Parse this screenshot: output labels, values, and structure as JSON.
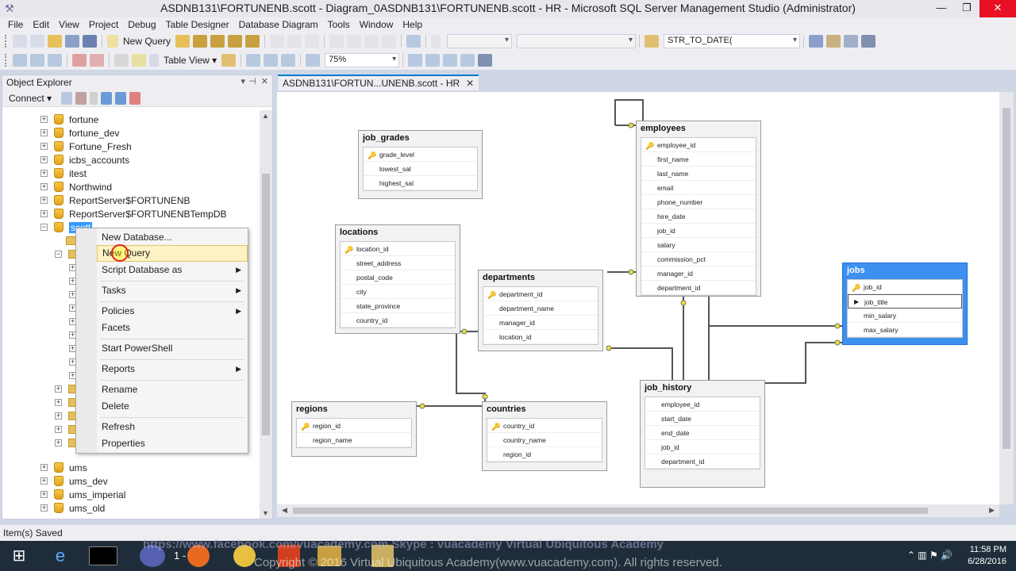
{
  "window": {
    "title": "ASDNB131\\FORTUNENB.scott - Diagram_0ASDNB131\\FORTUNENB.scott - HR - Microsoft SQL Server Management Studio (Administrator)",
    "minimize": "—",
    "restore": "❐",
    "close": "✕"
  },
  "menu": [
    "File",
    "Edit",
    "View",
    "Project",
    "Debug",
    "Table Designer",
    "Database Diagram",
    "Tools",
    "Window",
    "Help"
  ],
  "toolbar": {
    "new_query": "New Query",
    "function_combo": "STR_TO_DATE(",
    "table_view": "Table View",
    "zoom": "75%"
  },
  "object_explorer": {
    "title": "Object Explorer",
    "connect": "Connect",
    "nodes": [
      {
        "label": "fortune",
        "type": "db"
      },
      {
        "label": "fortune_dev",
        "type": "db"
      },
      {
        "label": "Fortune_Fresh",
        "type": "db"
      },
      {
        "label": "icbs_accounts",
        "type": "db"
      },
      {
        "label": "itest",
        "type": "db"
      },
      {
        "label": "Northwind",
        "type": "db"
      },
      {
        "label": "ReportServer$FORTUNENB",
        "type": "db"
      },
      {
        "label": "ReportServer$FORTUNENBTempDB",
        "type": "db"
      },
      {
        "label": "scott",
        "type": "db"
      }
    ],
    "nodes_after": [
      {
        "label": "ums",
        "type": "db"
      },
      {
        "label": "ums_dev",
        "type": "db"
      },
      {
        "label": "ums_imperial",
        "type": "db"
      },
      {
        "label": "ums_old",
        "type": "db"
      }
    ]
  },
  "context_menu": {
    "items": [
      {
        "label": "New Database..."
      },
      {
        "label": "New Query"
      },
      {
        "label": "Script Database as",
        "submenu": true
      },
      {
        "label": "Tasks",
        "submenu": true
      },
      {
        "label": "Policies",
        "submenu": true
      },
      {
        "label": "Facets"
      },
      {
        "label": "Start PowerShell"
      },
      {
        "label": "Reports",
        "submenu": true
      },
      {
        "label": "Rename"
      },
      {
        "label": "Delete"
      },
      {
        "label": "Refresh"
      },
      {
        "label": "Properties"
      }
    ]
  },
  "document_tab": {
    "label": "ASDNB131\\FORTUN...UNENB.scott - HR",
    "close": "✕"
  },
  "diagram": {
    "tables": {
      "job_grades": {
        "name": "job_grades",
        "columns": [
          "grade_level",
          "lowest_sal",
          "highest_sal"
        ]
      },
      "locations": {
        "name": "locations",
        "columns": [
          "location_id",
          "street_address",
          "postal_code",
          "city",
          "state_province",
          "country_id"
        ]
      },
      "departments": {
        "name": "departments",
        "columns": [
          "department_id",
          "department_name",
          "manager_id",
          "location_id"
        ]
      },
      "employees": {
        "name": "employees",
        "columns": [
          "employee_id",
          "first_name",
          "last_name",
          "email",
          "phone_number",
          "hire_date",
          "job_id",
          "salary",
          "commission_pct",
          "manager_id",
          "department_id"
        ]
      },
      "jobs": {
        "name": "jobs",
        "columns": [
          "job_id",
          "job_title",
          "min_salary",
          "max_salary"
        ]
      },
      "regions": {
        "name": "regions",
        "columns": [
          "region_id",
          "region_name"
        ]
      },
      "countries": {
        "name": "countries",
        "columns": [
          "country_id",
          "country_name",
          "region_id"
        ]
      },
      "job_history": {
        "name": "job_history",
        "columns": [
          "employee_id",
          "start_date",
          "end_date",
          "job_id",
          "department_id"
        ]
      }
    }
  },
  "status": {
    "text": "Item(s) Saved"
  },
  "taskbar": {
    "watermark_top": "https://www.facebook.com/vuacademy.com    Skype : vuacademy    Virtual Ubiquitous Academy",
    "watermark": "Copyright © 2016 Virtual Ubiquitous Academy(www.vuacademy.com). All rights reserved.",
    "ppt_label": "1 -",
    "time": "11:58 PM",
    "date": "6/28/2016"
  }
}
